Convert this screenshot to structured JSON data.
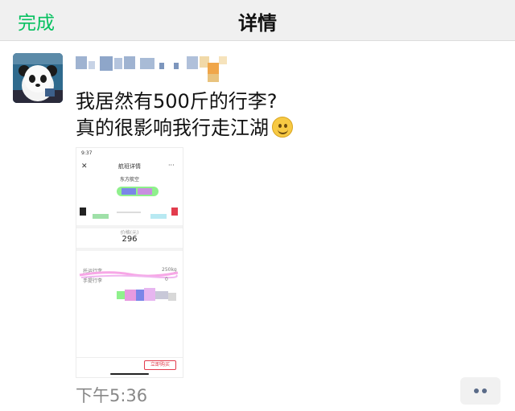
{
  "nav": {
    "done_label": "完成",
    "title": "详情"
  },
  "post": {
    "message_lines": [
      "我居然有500斤的行李?",
      "真的很影响我行走江湖"
    ],
    "emoji_icon": "smile-emoji-icon",
    "time": "下午5:36"
  },
  "screenshot": {
    "status_time": "9:37",
    "header": "航班详情",
    "airline": "东方航空",
    "price_label": "价格(元)",
    "value": "296",
    "rows": [
      {
        "label": "托运行李",
        "value": "250kg"
      },
      {
        "label": "手提行李",
        "value": "0"
      }
    ],
    "button_label": "立即购买"
  },
  "colors": {
    "accent": "#07c160",
    "time": "#888888"
  }
}
